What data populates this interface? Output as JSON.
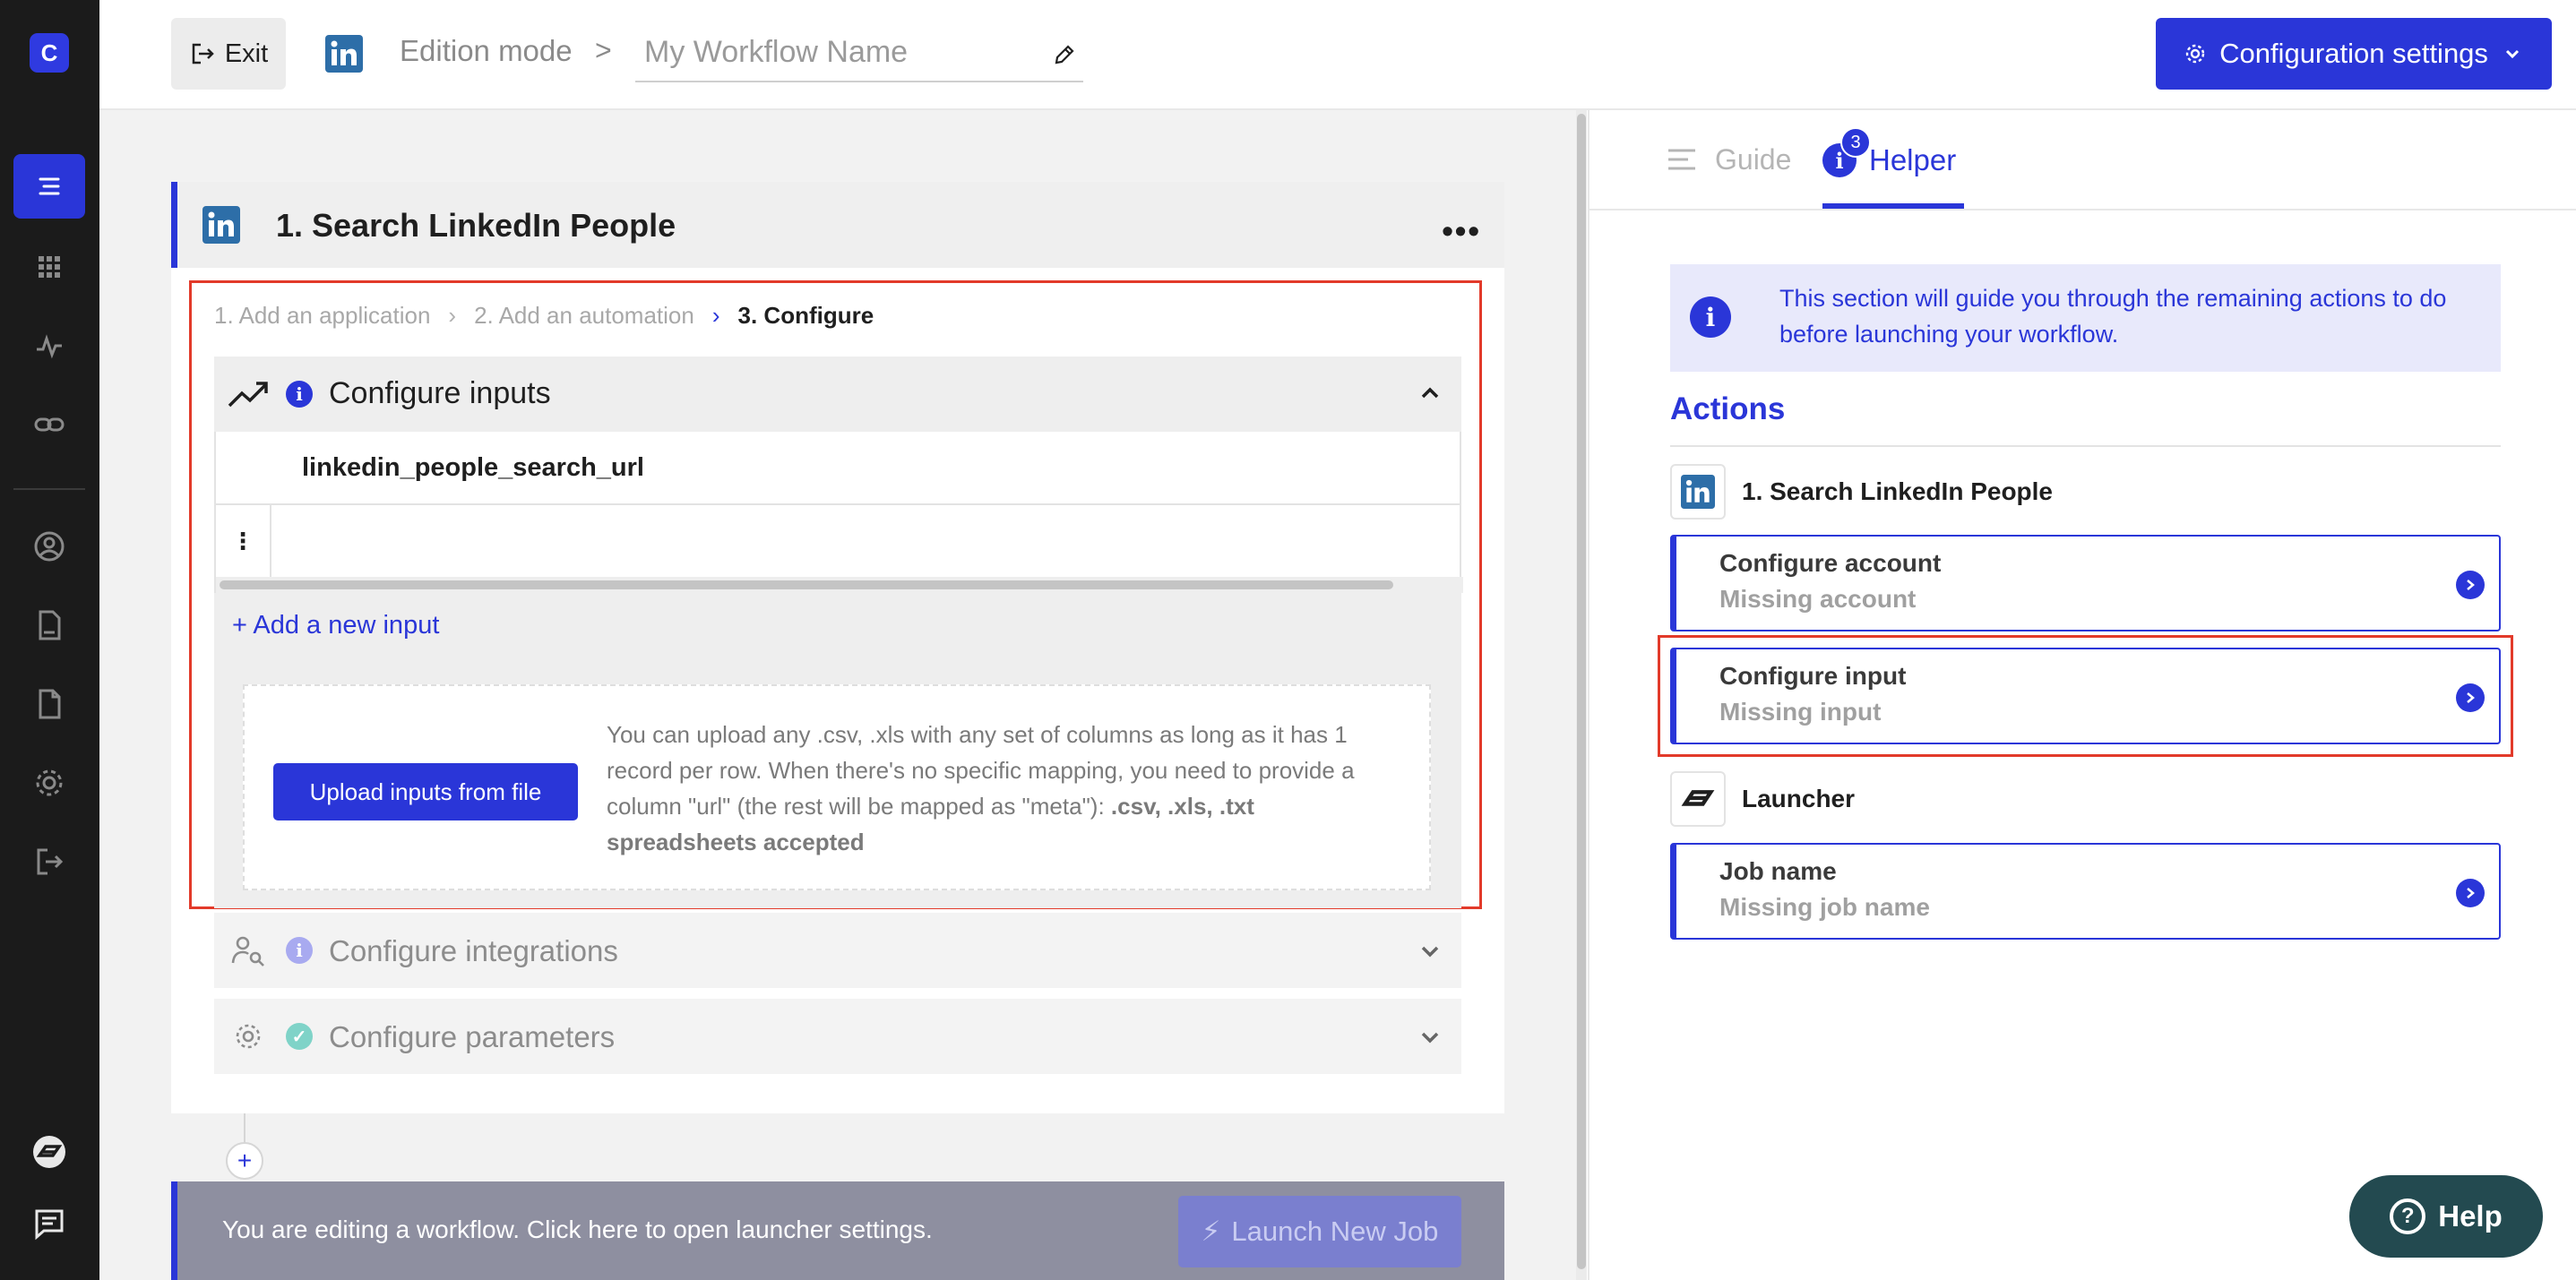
{
  "app": {
    "logo_letter": "C",
    "accent_color": "#2a36d8"
  },
  "sidebar": {
    "items": [
      {
        "icon": "workflow-icon",
        "active": true
      },
      {
        "icon": "apps-grid-icon"
      },
      {
        "icon": "activity-icon"
      },
      {
        "icon": "link-icon"
      },
      {
        "icon": "user-circle-icon"
      },
      {
        "icon": "document-icon"
      },
      {
        "icon": "file-icon"
      },
      {
        "icon": "gear-icon"
      },
      {
        "icon": "logout-icon"
      },
      {
        "icon": "launcher-icon"
      },
      {
        "icon": "chat-icon"
      }
    ]
  },
  "header": {
    "exit_label": "Exit",
    "mode_label": "Edition mode",
    "separator": ">",
    "workflow_name_placeholder": "My Workflow Name",
    "config_button_label": "Configuration settings"
  },
  "step_card": {
    "title": "1. Search LinkedIn People",
    "more": "•••",
    "steps": {
      "one": "1. Add an application",
      "two": "2. Add an automation",
      "three": "3. Configure"
    },
    "configure_inputs": {
      "title": "Configure inputs",
      "column_header": "linkedin_people_search_url",
      "kebab": "⋮",
      "add_input_label": "+ Add a new input",
      "upload_button": "Upload inputs from file",
      "upload_help": "You can upload any .csv, .xls with any set of columns as long as it has 1 record per row. When there's no specific mapping, you need to provide a column \"url\" (the rest will be mapped as \"meta\"): ",
      "upload_help_bold": ".csv, .xls, .txt spreadsheets accepted"
    },
    "configure_integrations": "Configure integrations",
    "configure_parameters": "Configure parameters"
  },
  "footer": {
    "editing_text": "You are editing a workflow. Click here to open launcher settings.",
    "launch_label": "Launch New Job",
    "add_step": "+"
  },
  "right_panel": {
    "tabs": {
      "guide": "Guide",
      "helper": "Helper",
      "helper_badge": "3"
    },
    "info_text": "This section will guide you through the remaining actions to do before launching your workflow.",
    "actions_title": "Actions",
    "groups": {
      "search_title": "1. Search LinkedIn People",
      "launcher_title": "Launcher"
    },
    "cards": {
      "account": {
        "title": "Configure account",
        "subtitle": "Missing account"
      },
      "input": {
        "title": "Configure input",
        "subtitle": "Missing input"
      },
      "job": {
        "title": "Job name",
        "subtitle": "Missing job name"
      }
    }
  },
  "help_button": {
    "label": "Help",
    "glyph": "?"
  }
}
